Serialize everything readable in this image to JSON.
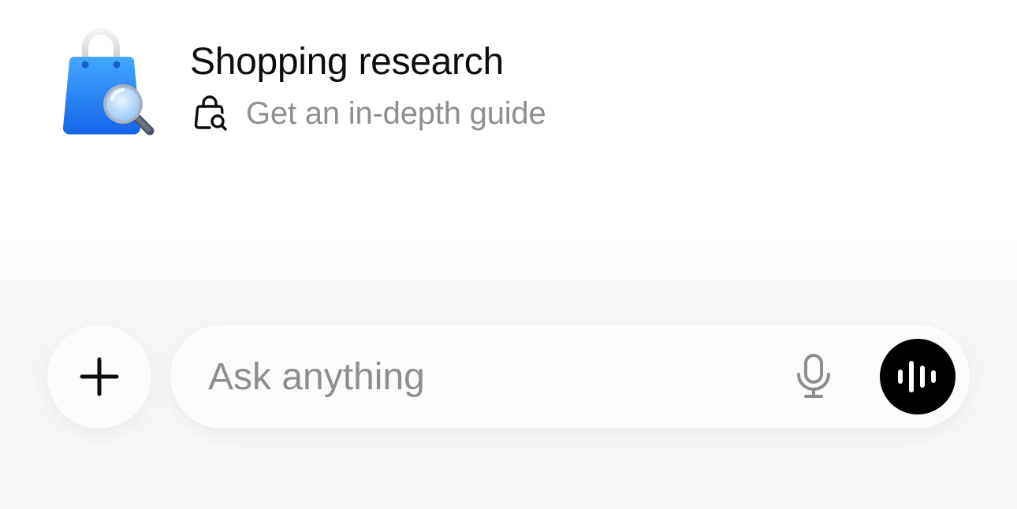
{
  "suggestion": {
    "title": "Shopping research",
    "subtitle": "Get an in-depth guide",
    "app_icon": "shopping-bag-magnifier-icon",
    "subtitle_icon": "bag-search-icon"
  },
  "composer": {
    "placeholder": "Ask anything",
    "plus_icon": "plus-icon",
    "mic_icon": "microphone-icon",
    "voice_icon": "voice-waveform-icon"
  },
  "colors": {
    "title": "#0d0d0d",
    "subtitle": "#8f8f8f",
    "placeholder": "#8e8e8e",
    "bag_blue": "#1e7cf0",
    "voice_button": "#000000",
    "composer_bg": "#fbfbfb"
  }
}
